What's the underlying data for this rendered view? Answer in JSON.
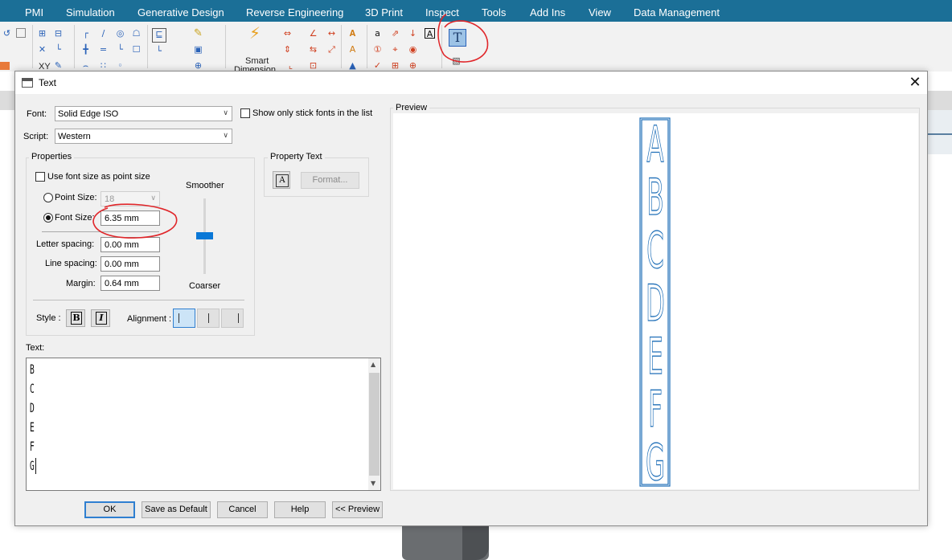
{
  "menubar": {
    "items": [
      "PMI",
      "Simulation",
      "Generative Design",
      "Reverse Engineering",
      "3D Print",
      "Inspect",
      "Tools",
      "Add Ins",
      "View",
      "Data Management"
    ]
  },
  "ribbon": {
    "smart_dimension_label": "Smart",
    "smart_dimension_label2": "Dimension",
    "xy_label": "XY",
    "text_button_glyph": "T"
  },
  "dialog": {
    "title": "Text",
    "font_label": "Font:",
    "font_value": "Solid Edge ISO",
    "stick_fonts_label": "Show only stick fonts in the list",
    "script_label": "Script:",
    "script_value": "Western",
    "properties_title": "Properties",
    "use_point_size_label": "Use font size as point size",
    "point_size_label": "Point Size:",
    "point_size_value": "18",
    "font_size_label": "Font Size:",
    "font_size_value": "6.35 mm",
    "smoother_label": "Smoother",
    "coarser_label": "Coarser",
    "letter_spacing_label": "Letter spacing:",
    "letter_spacing_value": "0.00 mm",
    "line_spacing_label": "Line spacing:",
    "line_spacing_value": "0.00 mm",
    "margin_label": "Margin:",
    "margin_value": "0.64 mm",
    "style_label": "Style :",
    "bold_glyph": "B",
    "italic_glyph": "I",
    "alignment_label": "Alignment :",
    "property_text_title": "Property Text",
    "format_button": "Format...",
    "text_label": "Text:",
    "text_lines": [
      "B",
      "C",
      "D",
      "E",
      "F",
      "G"
    ],
    "preview_title": "Preview",
    "preview_letters": [
      "A",
      "B",
      "C",
      "D",
      "E",
      "F",
      "G"
    ],
    "ok_button": "OK",
    "save_default_button": "Save as Default",
    "cancel_button": "Cancel",
    "help_button": "Help",
    "preview_button": "<< Preview"
  },
  "colors": {
    "menubar": "#1b6f97",
    "preview_stroke": "#1f6fb8",
    "annotation": "#e0262a",
    "slider_thumb": "#0a78d7"
  }
}
